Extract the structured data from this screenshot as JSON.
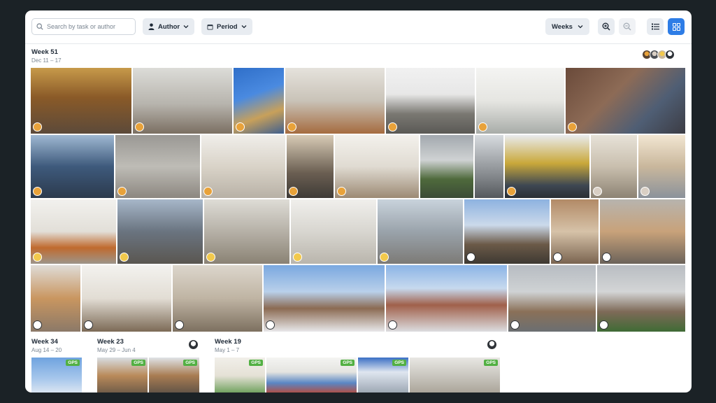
{
  "toolbar": {
    "search_placeholder": "Search by task or author",
    "author_label": "Author",
    "period_label": "Period",
    "weeks_label": "Weeks"
  },
  "weeks": [
    {
      "title": "Week 51",
      "range": "Dec 11 – 17"
    },
    {
      "title": "Week 34",
      "range": "Aug 14 – 20"
    },
    {
      "title": "Week 23",
      "range": "May 29 – Jun 4"
    },
    {
      "title": "Week 19",
      "range": "May 1 – 7"
    }
  ],
  "badge": "GPS",
  "colors": {
    "accent": "#2e7de6",
    "gps_badge": "#52b043",
    "frame": "#1b2226"
  }
}
